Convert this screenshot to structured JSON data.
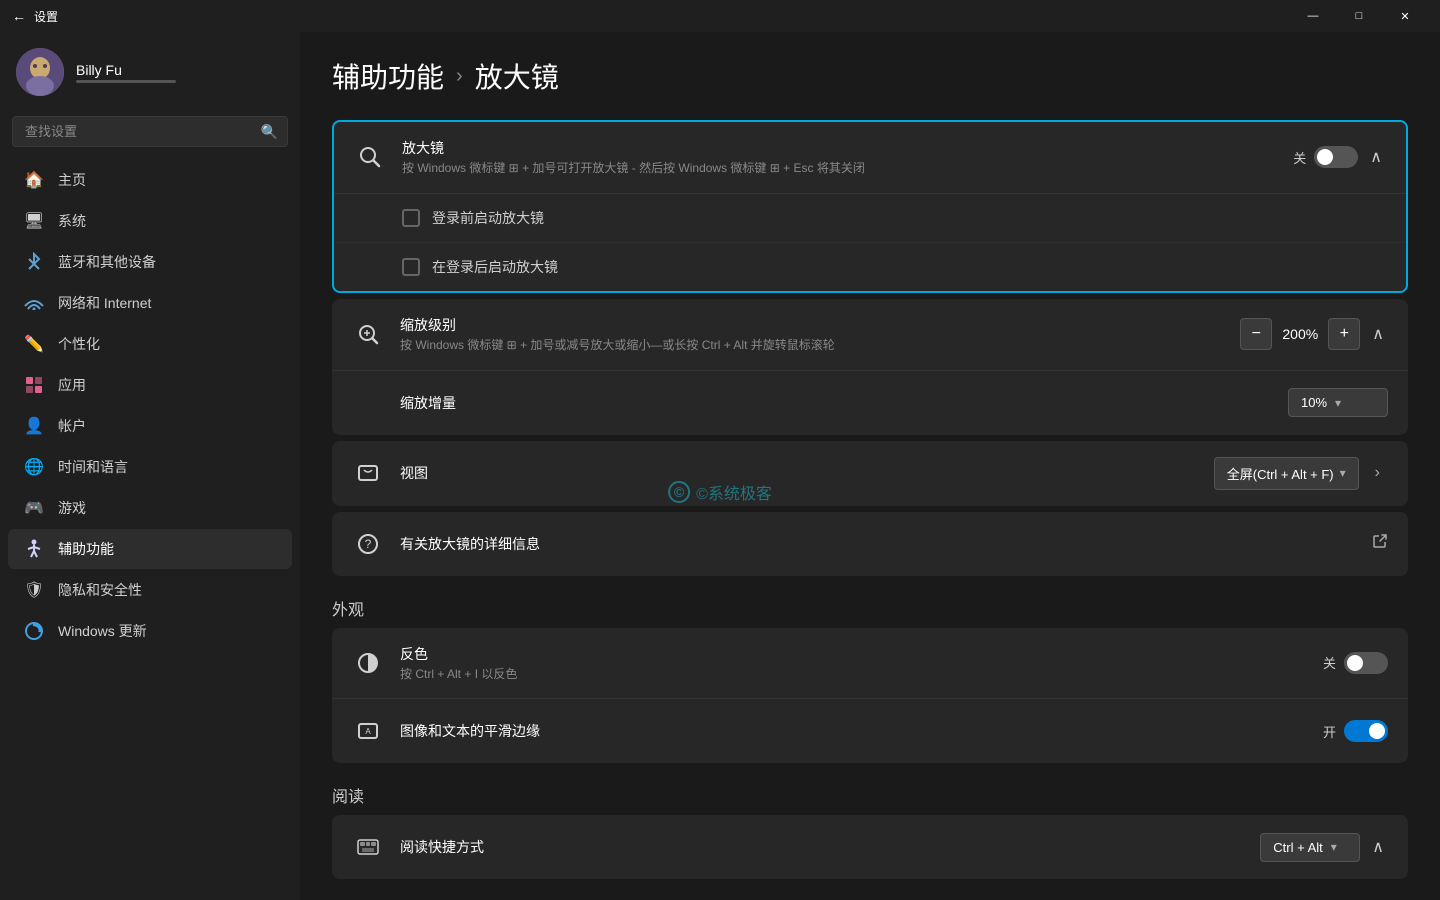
{
  "titlebar": {
    "back_label": "←",
    "title": "设置",
    "min_label": "—",
    "max_label": "□",
    "close_label": "✕"
  },
  "user": {
    "name": "Billy Fu",
    "subtitle_placeholder": ""
  },
  "search": {
    "placeholder": "查找设置"
  },
  "nav": {
    "items": [
      {
        "id": "home",
        "label": "主页",
        "icon": "🏠"
      },
      {
        "id": "system",
        "label": "系统",
        "icon": "🖥"
      },
      {
        "id": "bluetooth",
        "label": "蓝牙和其他设备",
        "icon": "🔵"
      },
      {
        "id": "network",
        "label": "网络和 Internet",
        "icon": "📶"
      },
      {
        "id": "personalization",
        "label": "个性化",
        "icon": "✏️"
      },
      {
        "id": "apps",
        "label": "应用",
        "icon": "🎯"
      },
      {
        "id": "accounts",
        "label": "帐户",
        "icon": "👤"
      },
      {
        "id": "time",
        "label": "时间和语言",
        "icon": "🌐"
      },
      {
        "id": "gaming",
        "label": "游戏",
        "icon": "🎮"
      },
      {
        "id": "accessibility",
        "label": "辅助功能",
        "icon": "♿"
      },
      {
        "id": "privacy",
        "label": "隐私和安全性",
        "icon": "🛡"
      },
      {
        "id": "windows-update",
        "label": "Windows 更新",
        "icon": "🔄"
      }
    ]
  },
  "page": {
    "breadcrumb_parent": "辅助功能",
    "breadcrumb_sep": "›",
    "breadcrumb_current": "放大镜",
    "title": "辅助功能 › 放大镜"
  },
  "magnifier_section": {
    "title": "放大镜",
    "desc": "按 Windows 微标键 ⊞ + 加号可打开放大镜 - 然后按 Windows 微标键 ⊞ + Esc 将其关闭",
    "toggle_label": "关",
    "toggle_on": false,
    "login_before_label": "登录前启动放大镜",
    "login_after_label": "在登录后启动放大镜"
  },
  "zoom_section": {
    "title": "缩放级别",
    "desc": "按 Windows 微标键 ⊞ + 加号或减号放大或缩小—或长按 Ctrl + Alt 并旋转鼠标滚轮",
    "value": "200%",
    "increment_label": "+",
    "decrement_label": "−",
    "increment_amount_label": "缩放增量",
    "increment_amount_value": "10%"
  },
  "view_section": {
    "title": "视图",
    "value": "全屏(Ctrl + Alt + F)"
  },
  "more_info_section": {
    "title": "有关放大镜的详细信息"
  },
  "appearance_section": {
    "heading": "外观",
    "invert_title": "反色",
    "invert_desc": "按 Ctrl + Alt + I 以反色",
    "invert_toggle_label": "关",
    "invert_on": false,
    "smooth_title": "图像和文本的平滑边缘",
    "smooth_toggle_label": "开",
    "smooth_on": true
  },
  "reading_section": {
    "heading": "阅读",
    "shortcut_title": "阅读快捷方式",
    "shortcut_value": "Ctrl + Alt"
  },
  "watermark": {
    "text": "©系统极客",
    "icon": "©"
  }
}
